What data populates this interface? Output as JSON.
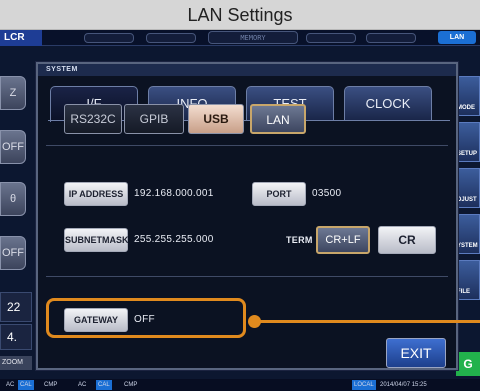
{
  "title": "LAN Settings",
  "bg": {
    "lcr": "LCR",
    "memory": "MEMORY",
    "lan": "LAN",
    "left_buttons": [
      "Z",
      "OFF",
      "θ",
      "OFF"
    ],
    "right_buttons": [
      "MODE",
      "SETUP",
      "DJUST",
      "YSTEM",
      "FILE"
    ],
    "readouts": [
      "22",
      "4."
    ],
    "zoom": "ZOOM",
    "green": "G",
    "status": [
      "AC",
      "CAL",
      "CMP",
      "AC",
      "CAL",
      "CMP",
      "LOCAL",
      "2014/04/07 15:25"
    ]
  },
  "dialog": {
    "title": "SYSTEM",
    "tabs": [
      "I/F",
      "INFO",
      "TEST",
      "CLOCK"
    ],
    "active_tab": "I/F",
    "interfaces": [
      "RS232C",
      "GPIB",
      "USB",
      "LAN"
    ],
    "selected_interface": "LAN",
    "ip_label": "IP ADDRESS",
    "ip_value": "192.168.000.001",
    "port_label": "PORT",
    "port_value": "03500",
    "subnet_label": "SUBNETMASK",
    "subnet_value": "255.255.255.000",
    "term_label": "TERM",
    "term_options": [
      "CR+LF",
      "CR"
    ],
    "term_selected": "CR+LF",
    "gateway_label": "GATEWAY",
    "gateway_value": "OFF",
    "exit_label": "EXIT"
  },
  "colors": {
    "callout": "#e08a1e",
    "usb_button": "#e8c9b6",
    "exit_button": "#2f5bbf",
    "screen_bg": "#0c1730"
  }
}
